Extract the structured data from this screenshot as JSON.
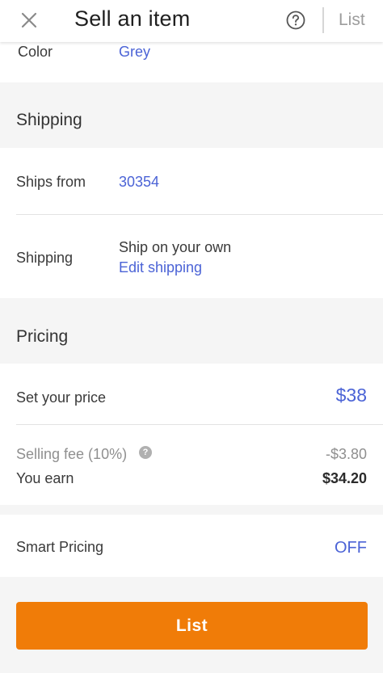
{
  "header": {
    "title": "Sell an item",
    "list_label": "List",
    "close_icon": "close-icon",
    "help_icon": "help-circle-icon"
  },
  "details": {
    "color_label": "Color",
    "color_value": "Grey"
  },
  "shipping": {
    "section_title": "Shipping",
    "ships_from_label": "Ships from",
    "ships_from_value": "30354",
    "shipping_label": "Shipping",
    "shipping_value": "Ship on your own",
    "edit_link": "Edit shipping"
  },
  "pricing": {
    "section_title": "Pricing",
    "price_label": "Set your price",
    "price_value": "$38",
    "fee_label": "Selling fee (10%)",
    "fee_value": "-$3.80",
    "earn_label": "You earn",
    "earn_value": "$34.20"
  },
  "smart_pricing": {
    "label": "Smart Pricing",
    "value": "OFF"
  },
  "footer": {
    "list_button": "List"
  },
  "colors": {
    "accent": "#f07c08",
    "link": "#4b63d6",
    "background": "#f5f5f5"
  }
}
